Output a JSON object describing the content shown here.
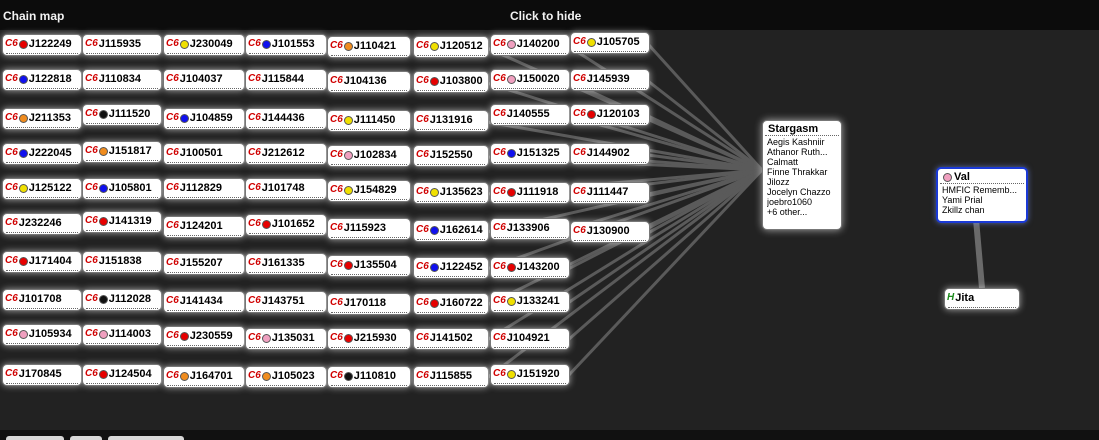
{
  "header": {
    "title": "Chain map",
    "hide_label": "Click to hide"
  },
  "colors": {
    "red": "#e60000",
    "blue": "#1010ee",
    "orange": "#f08c1e",
    "yellow": "#f0e000",
    "pink": "#f0a0c0",
    "black": "#111111"
  },
  "grid_columns": [
    [
      {
        "cls": "C6",
        "dot": "red",
        "name": "J122249"
      },
      {
        "cls": "C6",
        "dot": "blue",
        "name": "J122818"
      },
      {
        "cls": "C6",
        "dot": "orange",
        "name": "J211353"
      },
      {
        "cls": "C6",
        "dot": "blue",
        "name": "J222045"
      },
      {
        "cls": "C6",
        "dot": "yellow",
        "name": "J125122"
      },
      {
        "cls": "C6",
        "dot": "",
        "name": "J232246"
      },
      {
        "cls": "C6",
        "dot": "red",
        "name": "J171404"
      },
      {
        "cls": "C6",
        "dot": "",
        "name": "J101708"
      },
      {
        "cls": "C6",
        "dot": "pink",
        "name": "J105934"
      },
      {
        "cls": "C6",
        "dot": "",
        "name": "J170845"
      }
    ],
    [
      {
        "cls": "C6",
        "dot": "",
        "name": "J115935"
      },
      {
        "cls": "C6",
        "dot": "",
        "name": "J110834"
      },
      {
        "cls": "C6",
        "dot": "black",
        "name": "J111520"
      },
      {
        "cls": "C6",
        "dot": "orange",
        "name": "J151817"
      },
      {
        "cls": "C6",
        "dot": "blue",
        "name": "J105801"
      },
      {
        "cls": "C6",
        "dot": "red",
        "name": "J141319"
      },
      {
        "cls": "C6",
        "dot": "",
        "name": "J151838"
      },
      {
        "cls": "C6",
        "dot": "black",
        "name": "J112028"
      },
      {
        "cls": "C6",
        "dot": "pink",
        "name": "J114003"
      },
      {
        "cls": "C6",
        "dot": "red",
        "name": "J124504"
      }
    ],
    [
      {
        "cls": "C6",
        "dot": "yellow",
        "name": "J230049"
      },
      {
        "cls": "C6",
        "dot": "",
        "name": "J104037"
      },
      {
        "cls": "C6",
        "dot": "blue",
        "name": "J104859"
      },
      {
        "cls": "C6",
        "dot": "",
        "name": "J100501"
      },
      {
        "cls": "C6",
        "dot": "",
        "name": "J112829"
      },
      {
        "cls": "C6",
        "dot": "",
        "name": "J124201"
      },
      {
        "cls": "C6",
        "dot": "",
        "name": "J155207"
      },
      {
        "cls": "C6",
        "dot": "",
        "name": "J141434"
      },
      {
        "cls": "C6",
        "dot": "red",
        "name": "J230559"
      },
      {
        "cls": "C6",
        "dot": "orange",
        "name": "J164701"
      }
    ],
    [
      {
        "cls": "C6",
        "dot": "blue",
        "name": "J101553"
      },
      {
        "cls": "C6",
        "dot": "",
        "name": "J115844"
      },
      {
        "cls": "C6",
        "dot": "",
        "name": "J144436"
      },
      {
        "cls": "C6",
        "dot": "",
        "name": "J212612"
      },
      {
        "cls": "C6",
        "dot": "",
        "name": "J101748"
      },
      {
        "cls": "C6",
        "dot": "red",
        "name": "J101652"
      },
      {
        "cls": "C6",
        "dot": "",
        "name": "J161335"
      },
      {
        "cls": "C6",
        "dot": "",
        "name": "J143751"
      },
      {
        "cls": "C6",
        "dot": "pink",
        "name": "J135031"
      },
      {
        "cls": "C6",
        "dot": "orange",
        "name": "J105023"
      }
    ],
    [
      {
        "cls": "C6",
        "dot": "orange",
        "name": "J110421"
      },
      {
        "cls": "C6",
        "dot": "",
        "name": "J104136"
      },
      {
        "cls": "C6",
        "dot": "yellow",
        "name": "J111450"
      },
      {
        "cls": "C6",
        "dot": "pink",
        "name": "J102834"
      },
      {
        "cls": "C6",
        "dot": "yellow",
        "name": "J154829"
      },
      {
        "cls": "C6",
        "dot": "",
        "name": "J115923"
      },
      {
        "cls": "C6",
        "dot": "red",
        "name": "J135504"
      },
      {
        "cls": "C6",
        "dot": "",
        "name": "J170118"
      },
      {
        "cls": "C6",
        "dot": "red",
        "name": "J215930"
      },
      {
        "cls": "C6",
        "dot": "black",
        "name": "J110810"
      }
    ],
    [
      {
        "cls": "C6",
        "dot": "yellow",
        "name": "J120512"
      },
      {
        "cls": "C6",
        "dot": "red",
        "name": "J103800"
      },
      {
        "cls": "C6",
        "dot": "",
        "name": "J131916"
      },
      {
        "cls": "C6",
        "dot": "",
        "name": "J152550"
      },
      {
        "cls": "C6",
        "dot": "yellow",
        "name": "J135623"
      },
      {
        "cls": "C6",
        "dot": "blue",
        "name": "J162614"
      },
      {
        "cls": "C6",
        "dot": "blue",
        "name": "J122452"
      },
      {
        "cls": "C6",
        "dot": "red",
        "name": "J160722"
      },
      {
        "cls": "C6",
        "dot": "",
        "name": "J141502"
      },
      {
        "cls": "C6",
        "dot": "",
        "name": "J115855"
      }
    ],
    [
      {
        "cls": "C6",
        "dot": "pink",
        "name": "J140200"
      },
      {
        "cls": "C6",
        "dot": "pink",
        "name": "J150020"
      },
      {
        "cls": "C6",
        "dot": "",
        "name": "J140555"
      },
      {
        "cls": "C6",
        "dot": "blue",
        "name": "J151325"
      },
      {
        "cls": "C6",
        "dot": "red",
        "name": "J111918"
      },
      {
        "cls": "C6",
        "dot": "",
        "name": "J133906"
      },
      {
        "cls": "C6",
        "dot": "red",
        "name": "J143200"
      },
      {
        "cls": "C6",
        "dot": "yellow",
        "name": "J133241"
      },
      {
        "cls": "C6",
        "dot": "",
        "name": "J104921"
      },
      {
        "cls": "C6",
        "dot": "yellow",
        "name": "J151920"
      }
    ],
    [
      {
        "cls": "C6",
        "dot": "yellow",
        "name": "J105705"
      },
      {
        "cls": "C6",
        "dot": "",
        "name": "J145939"
      },
      {
        "cls": "C6",
        "dot": "red",
        "name": "J120103"
      },
      {
        "cls": "C6",
        "dot": "",
        "name": "J144902"
      },
      {
        "cls": "C6",
        "dot": "",
        "name": "J111447"
      },
      {
        "cls": "C6",
        "dot": "",
        "name": "J130900"
      }
    ]
  ],
  "stargasm": {
    "name": "Stargasm",
    "pilots": [
      "Aegis Kashniir",
      "Athanor Ruth...",
      "Calmatt",
      "Finne Thrakkar",
      "Jilozz",
      "Jocelyn Chazzo",
      "joebro1060",
      "+6 other..."
    ]
  },
  "val": {
    "name": "Val",
    "dot": "pink",
    "pilots": [
      "HMFIC Rememb...",
      "Yami Prial",
      "Zkillz chan"
    ]
  },
  "jita": {
    "cls": "H",
    "name": "Jita"
  }
}
